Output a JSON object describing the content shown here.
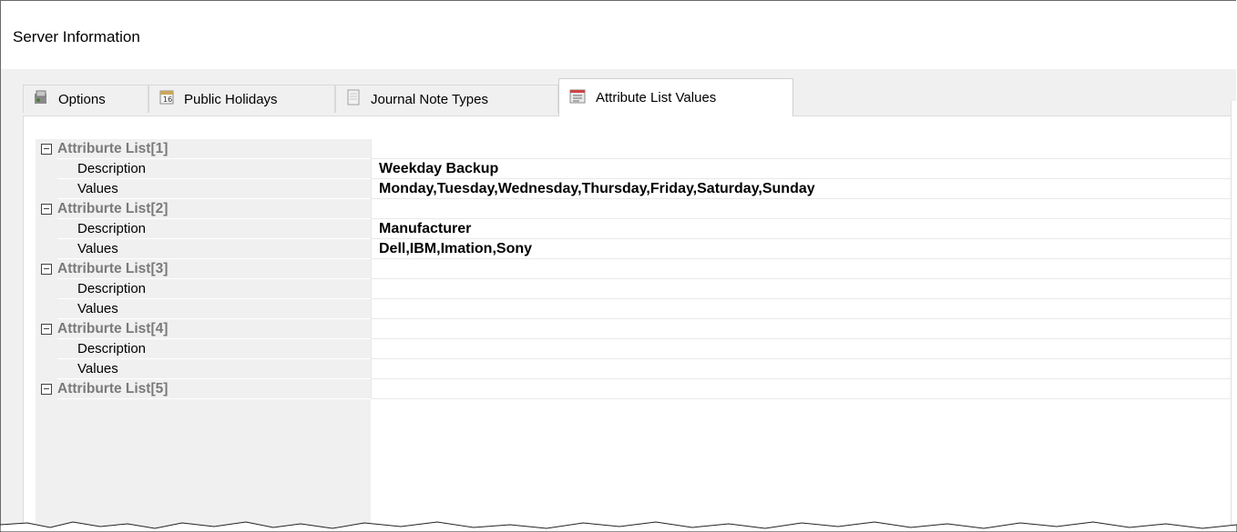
{
  "window": {
    "title": "Server Information"
  },
  "tabs": [
    {
      "label": "Options",
      "icon": "options-icon",
      "active": false
    },
    {
      "label": "Public Holidays",
      "icon": "calendar-icon",
      "active": false
    },
    {
      "label": "Journal Note Types",
      "icon": "journal-icon",
      "active": false
    },
    {
      "label": "Attribute List Values",
      "icon": "list-icon",
      "active": true
    }
  ],
  "grid": {
    "categories": [
      {
        "title": "Attriburte List[1]",
        "description_label": "Description",
        "description": "Weekday Backup",
        "values_label": "Values",
        "values": "Monday,Tuesday,Wednesday,Thursday,Friday,Saturday,Sunday"
      },
      {
        "title": "Attriburte List[2]",
        "description_label": "Description",
        "description": "Manufacturer",
        "values_label": "Values",
        "values": "Dell,IBM,Imation,Sony"
      },
      {
        "title": "Attriburte List[3]",
        "description_label": "Description",
        "description": "",
        "values_label": "Values",
        "values": ""
      },
      {
        "title": "Attriburte List[4]",
        "description_label": "Description",
        "description": "",
        "values_label": "Values",
        "values": ""
      },
      {
        "title": "Attriburte List[5]"
      }
    ]
  },
  "colors": {
    "category_text": "#7a7a7a",
    "label_column": "#f0f0f0"
  }
}
